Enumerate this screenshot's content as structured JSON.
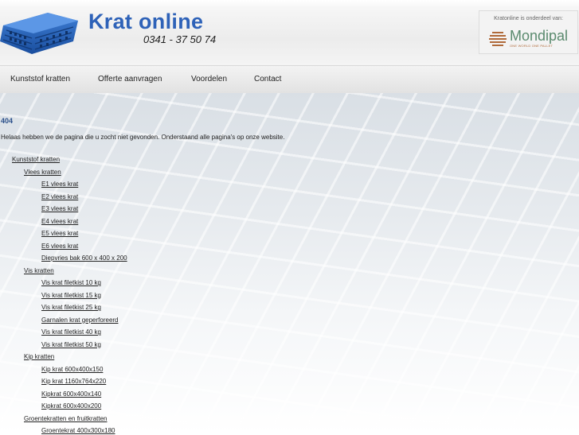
{
  "header": {
    "brand_title": "Krat online",
    "phone": "0341 - 37 50 74",
    "partner_label": "Kratonline is onderdeel van:",
    "partner_name": "Mondipal",
    "partner_tagline": "ONE WORLD ONE PALLET",
    "logo_icon": "crate-icon",
    "partner_icon": "mondipal-logo-icon"
  },
  "nav": {
    "items": [
      "Kunststof kratten",
      "Offerte aanvragen",
      "Voordelen",
      "Contact"
    ]
  },
  "content": {
    "error_title": "404",
    "error_message": "Helaas hebben we de pagina die u zocht niet gevonden. Onderstaand alle pagina's op onze website."
  },
  "sitemap": {
    "root": "Kunststof kratten",
    "vlees": {
      "label": "Vlees kratten",
      "items": [
        "E1 vlees krat",
        "E2 vlees krat",
        "E3 vlees krat",
        "E4 vlees krat",
        "E5 vlees krat",
        "E6 vlees krat",
        "Diepvries bak 600 x 400 x 200"
      ]
    },
    "vis": {
      "label": "Vis kratten",
      "items": [
        "Vis krat filetkist 10 kg",
        "Vis krat filetkist 15 kg",
        "Vis krat filetkist 25 kg",
        "Garnalen krat geperforeerd",
        "Vis krat filetkist 40 kg",
        "Vis krat filetkist 50 kg"
      ]
    },
    "kip": {
      "label": "Kip kratten",
      "items": [
        "Kip krat 600x400x150",
        "Kip krat 1160x764x220",
        "Kipkrat 600x400x140",
        "Kipkrat 600x400x200"
      ]
    },
    "groente": {
      "label": "Groentekratten en fruitkratten",
      "items": [
        "Groentekrat 400x300x180"
      ]
    }
  },
  "colors": {
    "brand_blue": "#2e62b8",
    "heading_blue": "#2a4f8a",
    "partner_green": "#5a8a6e"
  }
}
